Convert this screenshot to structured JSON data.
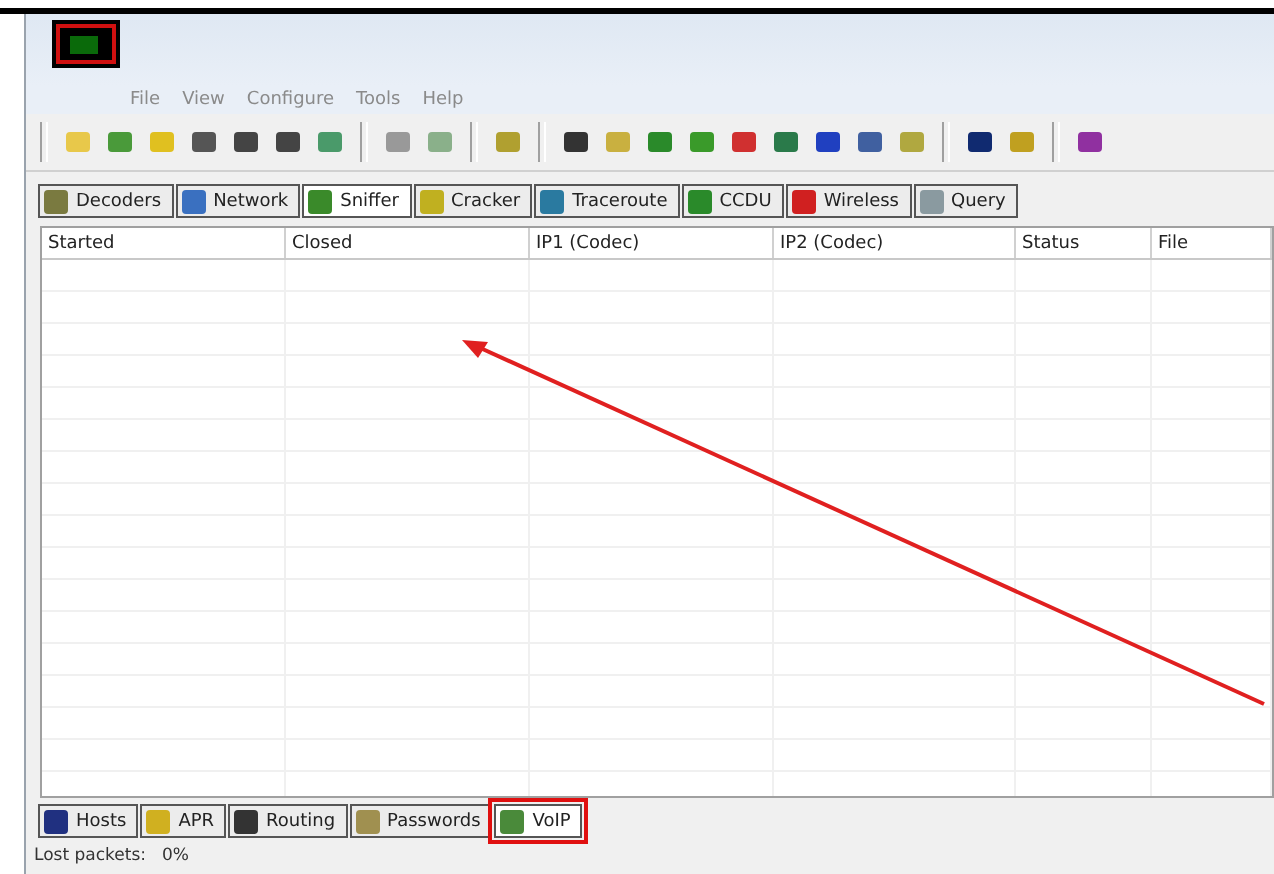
{
  "menu": [
    "File",
    "View",
    "Configure",
    "Tools",
    "Help"
  ],
  "top_tabs": [
    {
      "label": "Decoders",
      "selected": false
    },
    {
      "label": "Network",
      "selected": false
    },
    {
      "label": "Sniffer",
      "selected": true
    },
    {
      "label": "Cracker",
      "selected": false
    },
    {
      "label": "Traceroute",
      "selected": false
    },
    {
      "label": "CCDU",
      "selected": false
    },
    {
      "label": "Wireless",
      "selected": false
    },
    {
      "label": "Query",
      "selected": false
    }
  ],
  "table": {
    "columns": [
      "Started",
      "Closed",
      "IP1 (Codec)",
      "IP2 (Codec)",
      "Status",
      "File"
    ]
  },
  "bottom_tabs": [
    {
      "label": "Hosts",
      "selected": false,
      "highlighted": false
    },
    {
      "label": "APR",
      "selected": false,
      "highlighted": false
    },
    {
      "label": "Routing",
      "selected": false,
      "highlighted": false
    },
    {
      "label": "Passwords",
      "selected": false,
      "highlighted": false
    },
    {
      "label": "VoIP",
      "selected": true,
      "highlighted": true
    }
  ],
  "status_bar": {
    "label": "Lost packets:",
    "value": "0%"
  }
}
